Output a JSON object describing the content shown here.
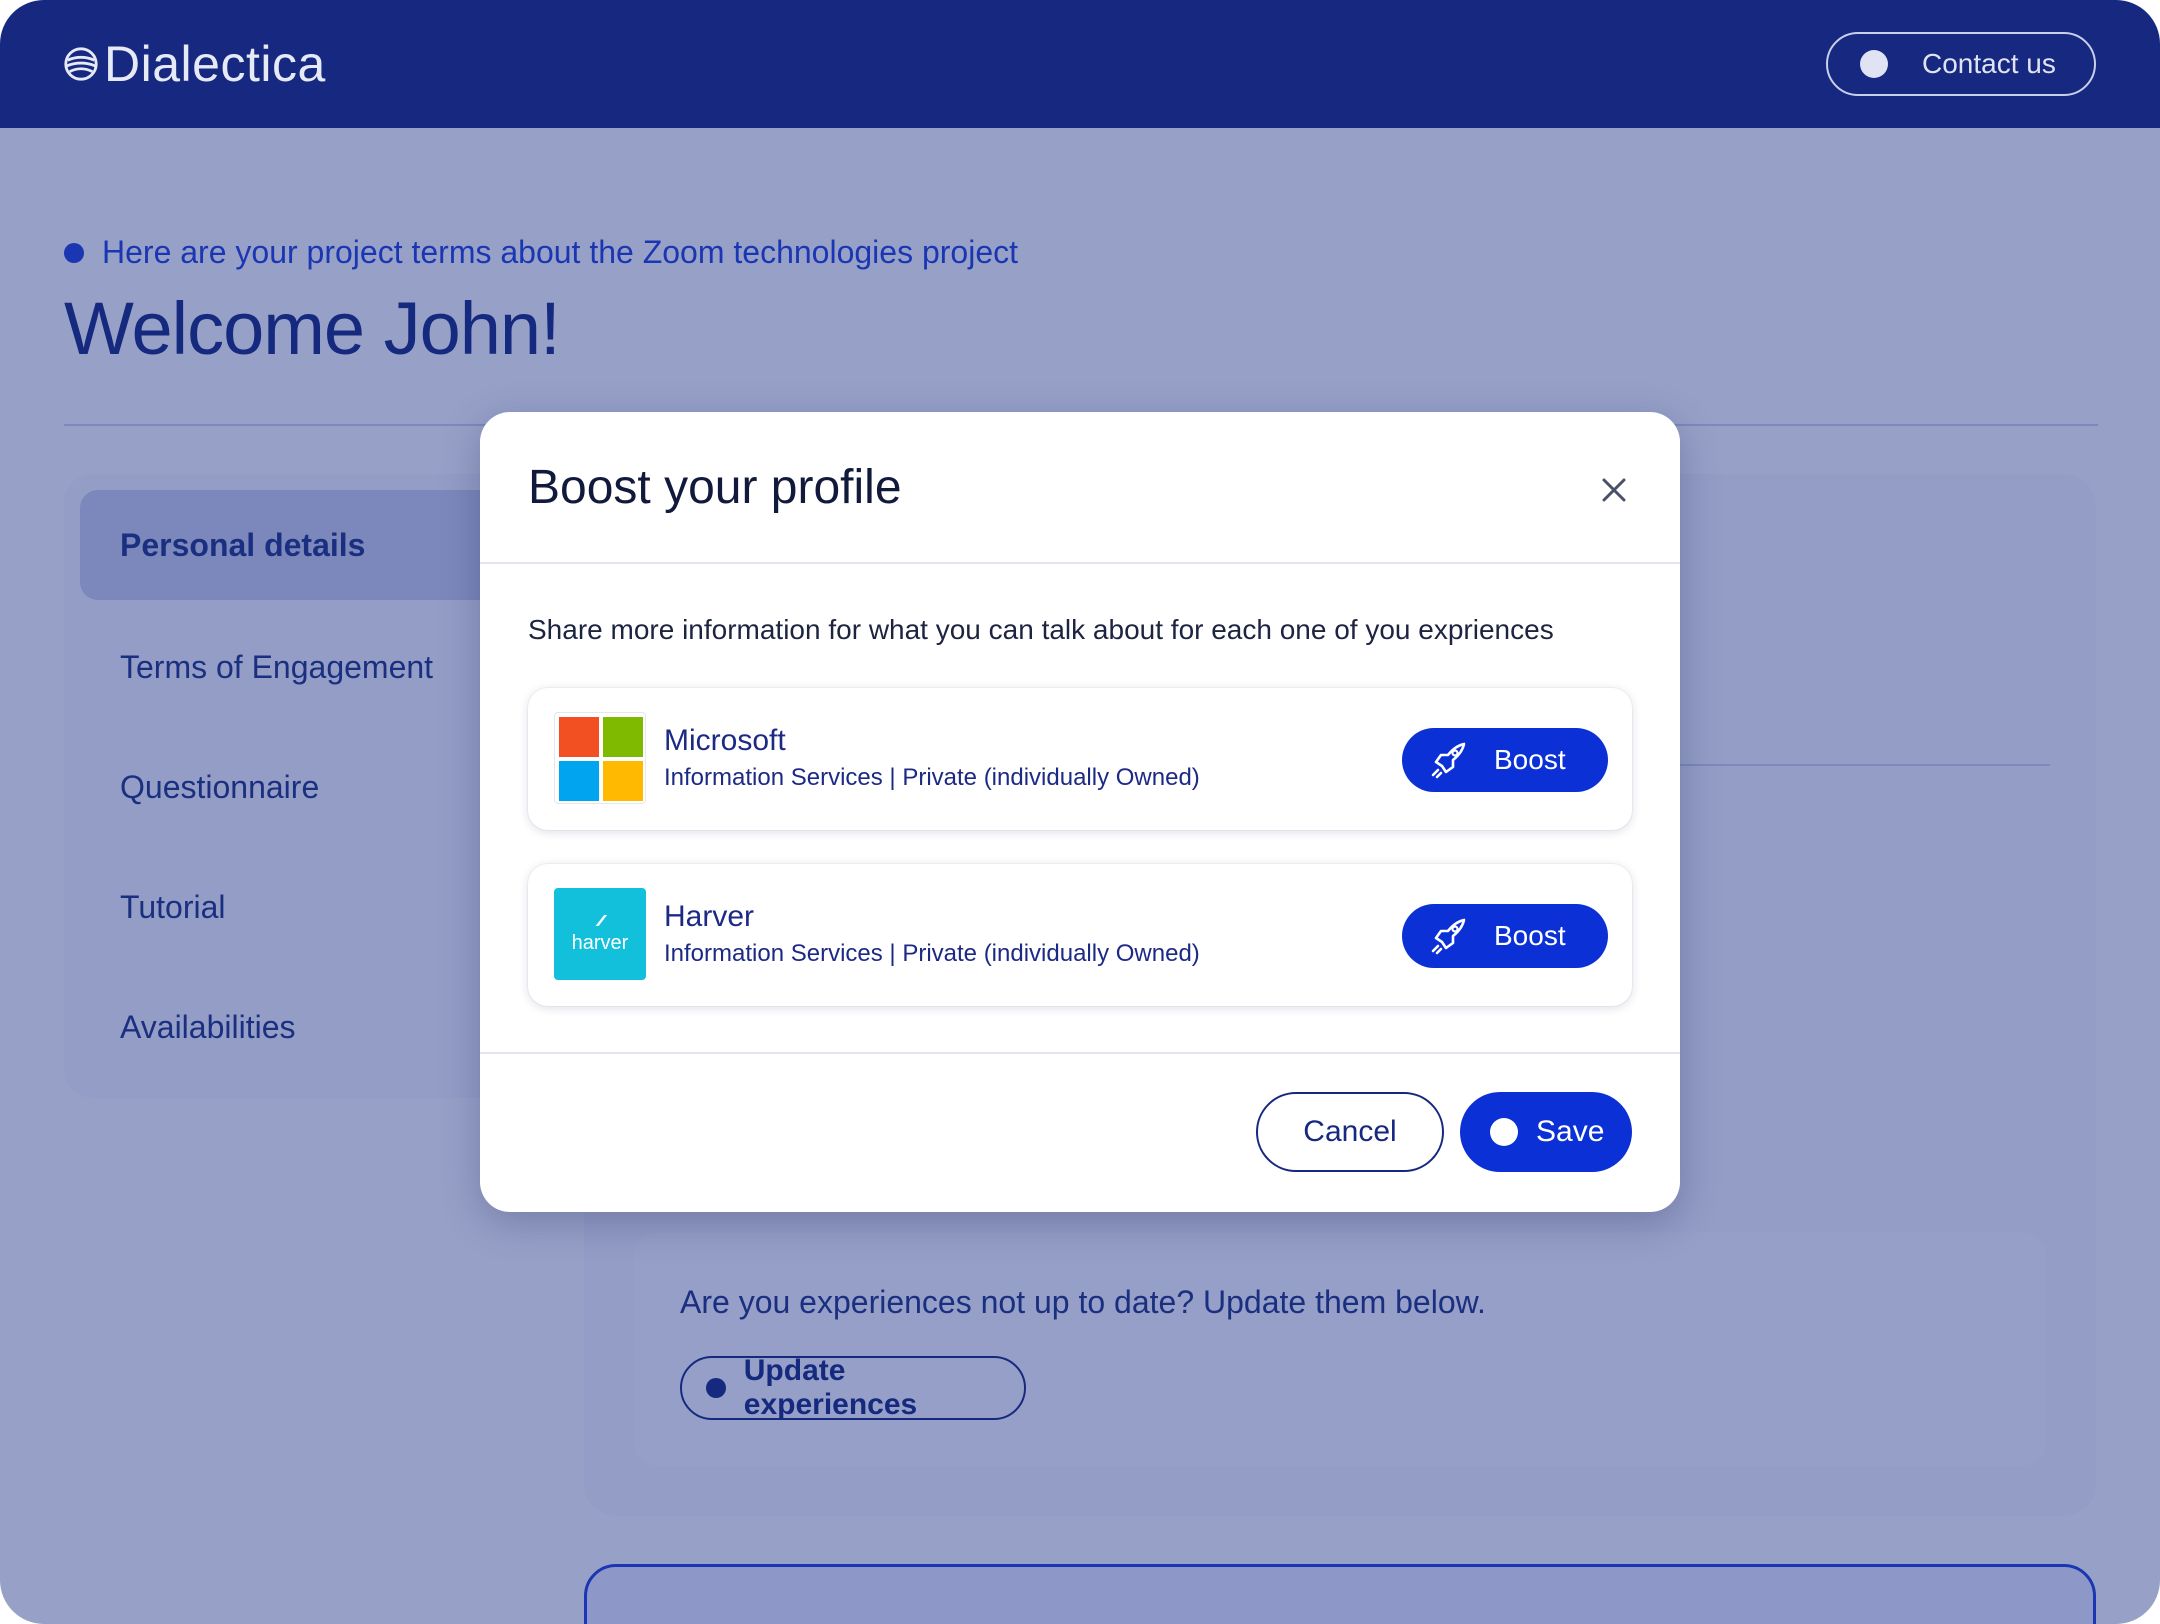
{
  "header": {
    "logo_text": "Dialectica",
    "contact_label": "Contact us"
  },
  "page": {
    "project_line": "Here are your project terms about the Zoom technologies project",
    "welcome": "Welcome John!",
    "sidebar": {
      "items": [
        {
          "label": "Personal details",
          "active": true
        },
        {
          "label": "Terms of Engagement"
        },
        {
          "label": "Questionnaire"
        },
        {
          "label": "Tutorial"
        },
        {
          "label": "Availabilities"
        }
      ]
    },
    "experiences_prompt": "Are you experiences not up to date? Update them below.",
    "update_button": "Update experiences"
  },
  "modal": {
    "title": "Boost your profile",
    "description": "Share more information for what you can talk about for each one of you expriences",
    "companies": [
      {
        "name": "Microsoft",
        "details": "Information Services | Private (individually Owned)",
        "logo": "microsoft-logo",
        "boost_label": "Boost"
      },
      {
        "name": "Harver",
        "details": "Information Services | Private (individually Owned)",
        "logo": "harver-logo",
        "logo_text": "harver",
        "boost_label": "Boost"
      }
    ],
    "cancel_label": "Cancel",
    "save_label": "Save"
  },
  "colors": {
    "header_bg": "#16287f",
    "primary": "#0b31d6",
    "overlay": "rgba(22,44,128,0.42)",
    "ms_red": "#f25022",
    "ms_green": "#7fba00",
    "ms_blue": "#00a4ef",
    "ms_yellow": "#ffb900",
    "harver_cyan": "#13c0dc"
  }
}
